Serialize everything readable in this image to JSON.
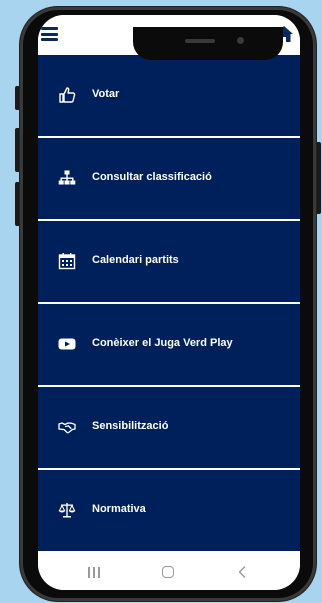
{
  "colors": {
    "background": "#a9d4ef",
    "menu_item": "#00205b",
    "menu_text": "#ffffff",
    "topbar_icon": "#0a2a5e",
    "navbar_icon": "#9a9a9a"
  },
  "topbar": {
    "menu_icon": "hamburger-icon",
    "home_icon": "home-icon"
  },
  "menu": {
    "items": [
      {
        "label": "Votar",
        "icon": "thumbs-up-icon"
      },
      {
        "label": "Consultar classificació",
        "icon": "sitemap-icon"
      },
      {
        "label": "Calendari partits",
        "icon": "calendar-icon"
      },
      {
        "label": "Conèixer el Juga Verd Play",
        "icon": "youtube-icon"
      },
      {
        "label": "Sensibilització",
        "icon": "handshake-icon"
      },
      {
        "label": "Normativa",
        "icon": "scale-icon"
      }
    ]
  },
  "navbar": {
    "recents_icon": "recents-icon",
    "home_icon": "home-circle-icon",
    "back_icon": "back-chevron-icon"
  }
}
